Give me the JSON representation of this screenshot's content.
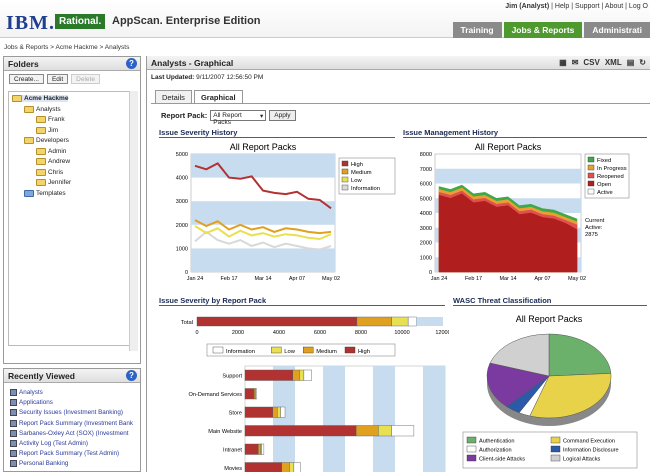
{
  "header": {
    "logo": "IBM.",
    "brand": "Rational.",
    "app_title": "AppScan. Enterprise Edition",
    "user": "Jim (Analyst)",
    "links": [
      "Help",
      "Support",
      "About",
      "Log O"
    ],
    "tabs": [
      "Training",
      "Jobs & Reports",
      "Administrati"
    ]
  },
  "breadcrumb": "Jobs & Reports > Acme Hackme > Analysts",
  "folders": {
    "title": "Folders",
    "buttons": [
      "Create...",
      "Edit",
      "Delete"
    ],
    "tree": [
      {
        "label": "Acme Hackme",
        "level": 0
      },
      {
        "label": "Analysts",
        "level": 1
      },
      {
        "label": "Frank",
        "level": 2
      },
      {
        "label": "Jim",
        "level": 2
      },
      {
        "label": "Developers",
        "level": 1
      },
      {
        "label": "Admin",
        "level": 2
      },
      {
        "label": "Andrew",
        "level": 2
      },
      {
        "label": "Chris",
        "level": 2
      },
      {
        "label": "Jennifer",
        "level": 2
      },
      {
        "label": "Templates",
        "level": 1
      }
    ]
  },
  "recent": {
    "title": "Recently Viewed",
    "items": [
      "Analysts",
      "Applications",
      "Security Issues (Investment Banking)",
      "Report Pack Summary (Investment Bank",
      "Sarbanes-Oxley Act (SOX) (Investment",
      "Activity Log (Test Admin)",
      "Report Pack Summary (Test Admin)",
      "Personal Banking"
    ]
  },
  "main": {
    "title": "Analysts - Graphical",
    "updated_label": "Last Updated:",
    "updated_value": "9/11/2007 12:56:50 PM",
    "toolbar": [
      "CSV",
      "XML"
    ],
    "tabs": [
      "Details",
      "Graphical"
    ],
    "report_pack_label": "Report Pack:",
    "report_pack_value": "All Report Packs",
    "apply": "Apply"
  },
  "chart_data": [
    {
      "section": "Issue Severity History",
      "type": "line",
      "title": "All Report Packs",
      "x": [
        "Jan 24",
        "Feb 17",
        "Mar 14",
        "Apr 07",
        "May 02"
      ],
      "ylim": [
        0,
        5000
      ],
      "yticks": [
        0,
        1000,
        2000,
        3000,
        4000,
        5000
      ],
      "series": [
        {
          "name": "High",
          "color": "#b23232",
          "values": [
            4500,
            4350,
            4600,
            4000,
            3950,
            4050,
            3450,
            3350,
            3300,
            3400,
            3100,
            3050,
            2700
          ]
        },
        {
          "name": "Medium",
          "color": "#e0a020",
          "values": [
            2200,
            1950,
            2150,
            1800,
            2000,
            1800,
            1900,
            1700,
            1850,
            1800,
            1700,
            1650,
            1700
          ]
        },
        {
          "name": "Low",
          "color": "#e8e050",
          "values": [
            1950,
            1650,
            1850,
            1500,
            1750,
            1550,
            1650,
            1500,
            1600,
            1550,
            1450,
            1400,
            1600
          ]
        },
        {
          "name": "Information",
          "color": "#d9d9d9",
          "values": [
            1300,
            1700,
            1350,
            1200,
            1350,
            1100,
            1250,
            1050,
            1200,
            1100,
            1000,
            950,
            1100
          ]
        }
      ]
    },
    {
      "section": "Issue Management History",
      "type": "area",
      "title": "All Report Packs",
      "x": [
        "Jan 24",
        "Feb 17",
        "Mar 14",
        "Apr 07",
        "May 02"
      ],
      "ylim": [
        0,
        8000
      ],
      "yticks": [
        0,
        1000,
        2000,
        3000,
        4000,
        5000,
        6000,
        7000,
        8000
      ],
      "annotation": [
        "Current",
        "Active:",
        "2875"
      ],
      "series": [
        {
          "name": "Fixed",
          "color": "#3fa84a",
          "values": [
            5800,
            5600,
            5900,
            5300,
            5400,
            5000,
            5100,
            4500,
            4600,
            4300,
            4200,
            3900,
            3600
          ]
        },
        {
          "name": "In Progress",
          "color": "#e8a030",
          "values": [
            5600,
            5400,
            5700,
            5100,
            5200,
            4800,
            4900,
            4300,
            4400,
            4100,
            4000,
            3700,
            3400
          ]
        },
        {
          "name": "Reopened",
          "color": "#e05050",
          "values": [
            5400,
            5200,
            5500,
            4900,
            5000,
            4600,
            4700,
            4100,
            4200,
            3900,
            3800,
            3500,
            3200
          ]
        },
        {
          "name": "Open",
          "color": "#b01e1e",
          "values": [
            5200,
            5000,
            5300,
            4700,
            4800,
            4400,
            4500,
            3900,
            4000,
            3700,
            3600,
            3300,
            2875
          ]
        },
        {
          "name": "Active",
          "color": "#ffffff",
          "values": []
        }
      ]
    },
    {
      "section": "Issue Severity by Report Pack",
      "type": "bar",
      "total_label": "Total",
      "total_values": [
        7800,
        1700,
        800,
        400
      ],
      "total_ticks": [
        0,
        2000,
        4000,
        6000,
        8000,
        10000,
        12000
      ],
      "legend": [
        "Information",
        "Low",
        "Medium",
        "High"
      ],
      "categories": [
        "Support",
        "On-Demand Services",
        "Store",
        "Main Website",
        "Intranet",
        "Movies"
      ],
      "series": [
        {
          "name": "High",
          "color": "#b23232",
          "values": [
            430,
            80,
            250,
            1000,
            120,
            330
          ]
        },
        {
          "name": "Medium",
          "color": "#e0a020",
          "values": [
            60,
            10,
            40,
            200,
            20,
            70
          ]
        },
        {
          "name": "Low",
          "color": "#e8e050",
          "values": [
            40,
            5,
            30,
            120,
            10,
            40
          ]
        },
        {
          "name": "Information",
          "color": "#ffffff",
          "values": [
            70,
            10,
            40,
            200,
            20,
            60
          ]
        }
      ],
      "xmax": 1800
    },
    {
      "section": "WASC Threat Classification",
      "type": "pie",
      "title": "All Report Packs",
      "series": [
        {
          "name": "Authentication",
          "color": "#6bb06b",
          "value": 24
        },
        {
          "name": "Command Execution",
          "color": "#e8d24a",
          "value": 31
        },
        {
          "name": "Authorization",
          "color": "#ffffff",
          "value": 3
        },
        {
          "name": "Information Disclosure",
          "color": "#2a5aa8",
          "value": 4
        },
        {
          "name": "Client-side Attacks",
          "color": "#7a3aa0",
          "value": 18
        },
        {
          "name": "Logical Attacks",
          "color": "#d0d0d0",
          "value": 20
        }
      ]
    }
  ]
}
